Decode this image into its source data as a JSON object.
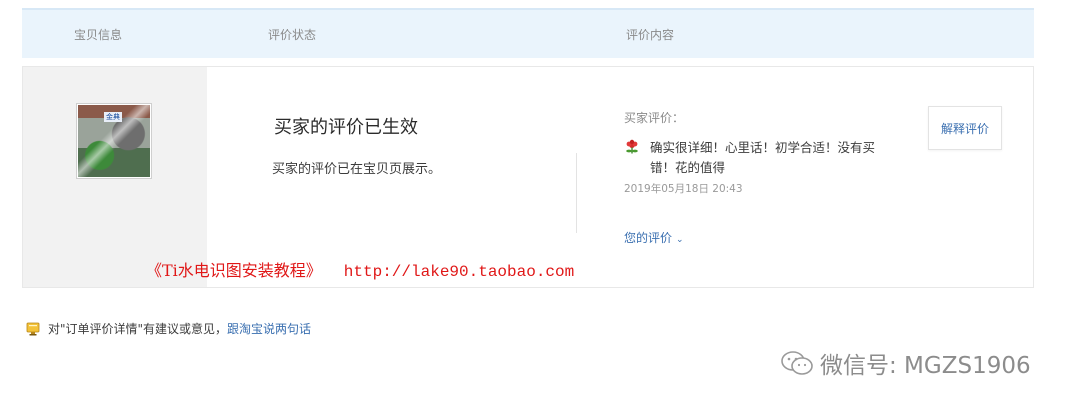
{
  "header": {
    "col_item": "宝贝信息",
    "col_status": "评价状态",
    "col_content": "评价内容"
  },
  "item": {
    "thumb_badge": "金典"
  },
  "status": {
    "title": "买家的评价已生效",
    "description": "买家的评价已在宝贝页展示。"
  },
  "review": {
    "label": "买家评价：",
    "comment": "确实很详细！心里话！初学合适！没有买错！花的值得",
    "time": "2019年05月18日 20:43",
    "your_review": "您的评价",
    "explain_button": "解释评价"
  },
  "watermark": {
    "title": "《Ti水电识图安装教程》",
    "url": "http://lake90.taobao.com"
  },
  "feedback": {
    "text": "对\"订单评价详情\"有建议或意见，",
    "link": "跟淘宝说两句话"
  },
  "wechat": {
    "text": "微信号: MGZS1906"
  }
}
